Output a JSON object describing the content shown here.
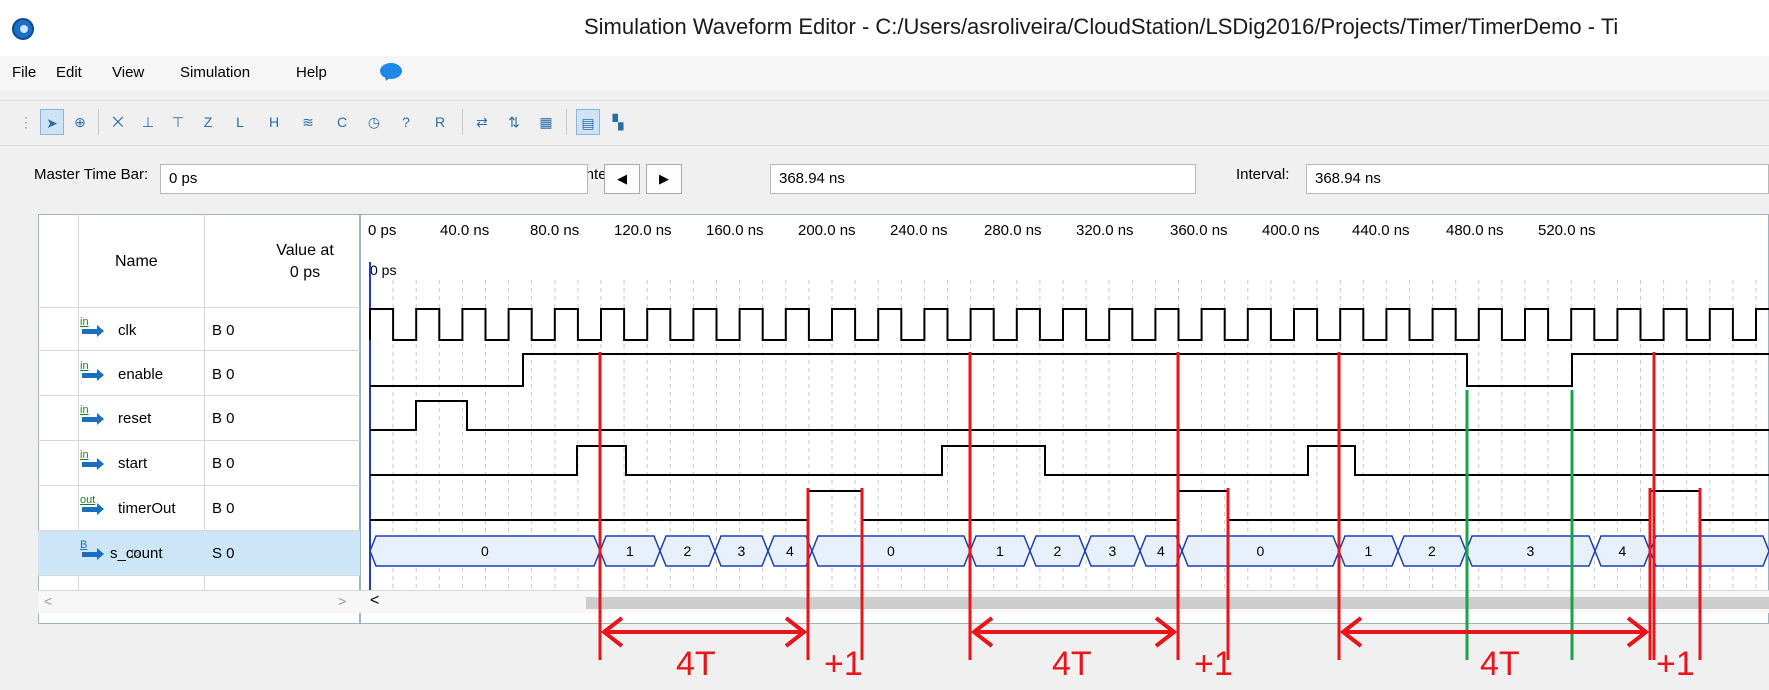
{
  "window": {
    "title": "Simulation Waveform Editor - C:/Users/asroliveira/CloudStation/LSDig2016/Projects/Timer/TimerDemo - Ti"
  },
  "menu": {
    "items": [
      {
        "label": "File"
      },
      {
        "label": "Edit"
      },
      {
        "label": "View"
      },
      {
        "label": "Simulation"
      },
      {
        "label": "Help"
      }
    ]
  },
  "toolbar": {
    "icons": [
      "pointer-icon",
      "zoom-icon",
      "uninitialized-icon",
      "force-low-icon",
      "force-high-icon",
      "high-impedance-icon",
      "weak-low-icon",
      "weak-high-icon",
      "invert-icon",
      "count-value-icon",
      "overwrite-clock-icon",
      "random-values-icon",
      "arbitrary-value-icon",
      "snap-to-grid-icon",
      "sort-icon",
      "grid-icon"
    ]
  },
  "timebar": {
    "master_label": "Master Time Bar:",
    "master_value": "0 ps",
    "pointer_label": "Pointer:",
    "pointer_value": "368.94 ns",
    "interval_label": "Interval:",
    "interval_value": "368.94 ns",
    "prev_icon": "◀",
    "next_icon": "▶"
  },
  "signal_panel": {
    "header_name": "Name",
    "header_value_line1": "Value at",
    "header_value_line2": "0 ps",
    "signals": [
      {
        "pin": "in",
        "name": "clk",
        "value": "B 0"
      },
      {
        "pin": "in",
        "name": "enable",
        "value": "B 0"
      },
      {
        "pin": "in",
        "name": "reset",
        "value": "B 0"
      },
      {
        "pin": "in",
        "name": "start",
        "value": "B 0"
      },
      {
        "pin": "out",
        "name": "timerOut",
        "value": "B 0"
      },
      {
        "pin": "bus",
        "name": "s_count",
        "value": "S 0"
      }
    ],
    "scroll_left": "<",
    "scroll_right": ">"
  },
  "waveform": {
    "cursor_label": "0 ps",
    "time_ticks": [
      "0 ps",
      "40.0 ns",
      "80.0 ns",
      "120.0 ns",
      "160.0 ns",
      "200.0 ns",
      "240.0 ns",
      "280.0 ns",
      "320.0 ns",
      "360.0 ns",
      "400.0 ns",
      "440.0 ns",
      "480.0 ns",
      "520.0 ns"
    ],
    "s_count_values": [
      "0",
      "1",
      "2",
      "3",
      "4",
      "0",
      "1",
      "2",
      "3",
      "4",
      "0",
      "1",
      "2",
      "3",
      "4"
    ],
    "scroll_left": "<"
  },
  "annotations": {
    "labels": [
      "4T",
      "+1",
      "4T",
      "+1",
      "4T",
      "+1"
    ],
    "colors": {
      "red": "#e8161b",
      "green": "#1aa34a"
    }
  }
}
